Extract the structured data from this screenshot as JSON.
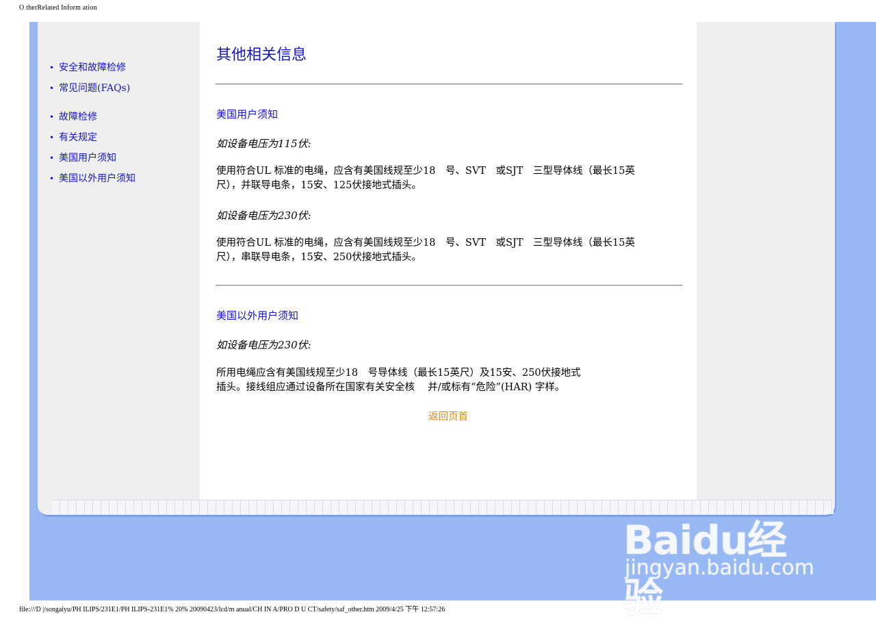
{
  "print_header": "O therRelated Inform ation",
  "print_footer": "file:///D |/songaiyu/PH ILIPS/231E1/PH ILIPS-231E1% 20% 20090423/lcd/m anual/CH IN A/PRO D U CT/safety/saf_other.htm 2009/4/25 下午 12:57:26",
  "sidebar": {
    "items": [
      {
        "label": "安全和故障检修"
      },
      {
        "label": "常见问题(FAQs)"
      },
      {
        "label": "故障检修"
      },
      {
        "label": "有关规定"
      },
      {
        "label": "美国用户须知"
      },
      {
        "label": "美国以外用户须知"
      }
    ]
  },
  "main": {
    "title": "其他相关信息",
    "us_section": {
      "heading": "美国用户须知",
      "v115_label": "如设备电压为115伏:",
      "v115_text_line1": "使用符合UL 标准的电绳，应含有美国线规至少18　号、SVT　或SJT　三型导体线（最长15英",
      "v115_text_line2": "尺），并联导电条，15安、125伏接地式插头。",
      "v230_label": "如设备电压为230伏:",
      "v230_text_line1": "使用符合UL 标准的电绳，应含有美国线规至少18　号、SVT　或SJT　三型导体线（最长15英",
      "v230_text_line2": "尺），串联导电条，15安、250伏接地式插头。"
    },
    "non_us_section": {
      "heading": "美国以外用户须知",
      "v230_label": "如设备电压为230伏:",
      "text_line1": "所用电绳应含有美国线规至少18　号导体线（最长15英尺）及15安、250伏接地式",
      "text_line2": "插头。接线组应通过设备所在国家有关安全核　 并/或标有“危险”(HAR) 字样。"
    },
    "back_link": "返回页首"
  },
  "watermark": {
    "logo": "Baidu经验",
    "url": "jingyan.baidu.com"
  },
  "colors": {
    "link": "#1414cc",
    "back_link": "#dd8a10",
    "background_blue": "#98b8f4",
    "panel_gray": "#efefef"
  }
}
